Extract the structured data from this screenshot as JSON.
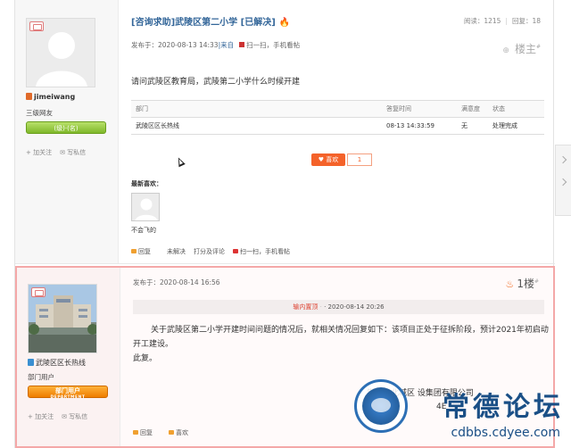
{
  "post1": {
    "user": {
      "name": "jimeiwang",
      "group": "三级网友",
      "rank_label": "(级)·(名)",
      "follow": "+ 加关注",
      "message": "✉ 写私信"
    },
    "title": "[咨询求助]武陵区第二小学 [已解决]",
    "stats": {
      "views": "阅读：1215",
      "replies": "回复：18"
    },
    "meta": {
      "posted": "发布于：2020-08-13 14:33",
      "via": "|来自",
      "qr_text": "扫一扫，手机看帖"
    },
    "floor_label": "楼主",
    "question": "请问武陵区教育局，武陵第二小学什么时候开建",
    "response_table": {
      "headers": [
        "部门",
        "答复时间",
        "满意度",
        "状态"
      ],
      "rows": [
        [
          "武陵区区长热线",
          "08-13 14:33:59",
          "无",
          "处理完成"
        ]
      ]
    },
    "like": {
      "label": "♥ 喜欢",
      "count": "1"
    },
    "recent_likes_label": "最新喜欢：",
    "recent_like_user": "不会飞的",
    "actions": [
      "回复",
      "未解决",
      "打分及评论"
    ],
    "action_qr": "扫一扫，手机看帖"
  },
  "post2": {
    "user": {
      "name": "武陵区区长热线",
      "group": "部门用户",
      "rank_label": "部门用户",
      "rank_sub": "DEPARTMENT",
      "follow": "+ 加关注",
      "message": "✉ 写私信"
    },
    "meta": {
      "posted": "发布于：2020-08-14 16:56"
    },
    "floor_label": "1楼",
    "notice": {
      "label": "输内置顶",
      "dash": "·",
      "date": "· 2020-08-14 20:26"
    },
    "body_p1": "关于武陵区第二小学开建时间问题的情况后，就相关情况回复如下：该项目正处于征拆阶段，预计2021年初启动开工建设。",
    "body_p2": "此复。",
    "signoff": "常德江北城区   设集团有限公司",
    "signoff2": "4E",
    "actions": [
      "回复",
      "喜欢"
    ]
  },
  "watermark": {
    "text": "常德论坛",
    "url": "cdbbs.cdyee.com"
  }
}
